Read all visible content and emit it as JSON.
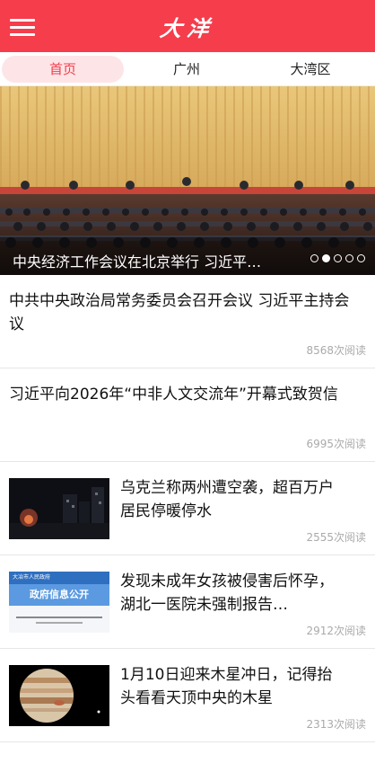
{
  "header": {
    "app_title": "大洋",
    "menu_icon": "menu-icon"
  },
  "tabs": [
    {
      "label": "首页",
      "active": true
    },
    {
      "label": "广州",
      "active": false
    },
    {
      "label": "大湾区",
      "active": false
    }
  ],
  "banner": {
    "caption": "中央经济工作会议在北京举行 习近平…",
    "slides_total": 5,
    "active_slide": 2
  },
  "articles": [
    {
      "title": "中共中央政治局常务委员会召开会议 习近平主持会议",
      "views": "8568次阅读",
      "has_thumb": false
    },
    {
      "title": "习近平向2026年“中非人文交流年”开幕式致贺信",
      "views": "6995次阅读",
      "has_thumb": false
    },
    {
      "title": "乌克兰称两州遭空袭，超百万户居民停暖停水",
      "views": "2555次阅读",
      "has_thumb": true,
      "thumb": "night-city-photo"
    },
    {
      "title": "发现未成年女孩被侵害后怀孕，湖北一医院未强制报告…",
      "views": "2912次阅读",
      "has_thumb": true,
      "thumb": "gov-info-screenshot",
      "thumb_text": {
        "site": "大冶市人民政府",
        "banner": "政府信息公开"
      }
    },
    {
      "title": "1月10日迎来木星冲日，记得抬头看看天顶中央的木星",
      "views": "2313次阅读",
      "has_thumb": true,
      "thumb": "jupiter-photo"
    }
  ],
  "colors": {
    "brand": "#f53d4c",
    "tab_active_bg": "#fde5e7",
    "meta": "#aaaaaa"
  }
}
